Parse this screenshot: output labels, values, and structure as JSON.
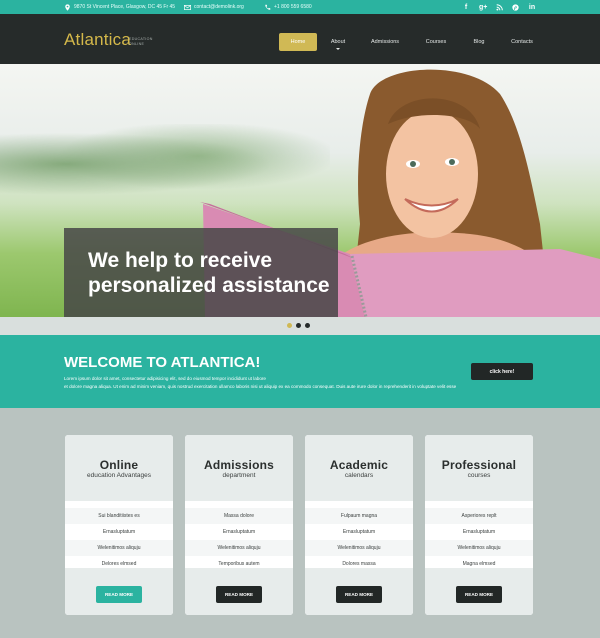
{
  "topbar": {
    "address": "9870 St Vincent Place, Glasgow, DC 45 Fr 45",
    "email": "contact@demolink.org",
    "phone": "+1 800 559 6580",
    "social": [
      "f",
      "g+",
      "rss",
      "p",
      "in"
    ]
  },
  "header": {
    "logo": "Atlantica",
    "tagline_line1": "EDUCATION",
    "tagline_line2": "ONLINE",
    "nav": [
      "Home",
      "About",
      "Admissions",
      "Courses",
      "Blog",
      "Contacts"
    ],
    "active_nav": "Home"
  },
  "hero": {
    "caption_line1": "We help to receive",
    "caption_line2": "personalized assistance",
    "slides_count": 3,
    "active_slide": 1
  },
  "welcome": {
    "title": "WELCOME TO ATLANTICA!",
    "text_line1": "Lorem ipsum dolor sit amet, consectetur adipisicing elit, sed do eiusmod tempor incididunt ut labore",
    "text_line2": "et dolore magna aliqua. Ut enim ad minim veniam, quis nostrud exercitation ullamco laboris nisi ut aliquip ex ea commodo consequat. Duis aute irure dolor in reprehenderit in voluptate velit esse",
    "button": "click here!"
  },
  "cards": [
    {
      "title": "Online",
      "subtitle": "education Advantages",
      "items": [
        "Sui blanditiistes es",
        "Ernasluptatum",
        "Welenitimos aliquju",
        "Delores elmsed"
      ],
      "button": "READ MORE",
      "accent": "#2bb3a0"
    },
    {
      "title": "Admissions",
      "subtitle": "department",
      "items": [
        "Massa dolore",
        "Ernasluptatum",
        "Welenitimos aliquju",
        "Temporibus autem"
      ],
      "button": "READ MORE",
      "accent": "#222726"
    },
    {
      "title": "Academic",
      "subtitle": "calendars",
      "items": [
        "Fulpaum magna",
        "Ernasluptatum",
        "Welenitimos aliquju",
        "Dolores massa"
      ],
      "button": "READ MORE",
      "accent": "#222726"
    },
    {
      "title": "Professional",
      "subtitle": "courses",
      "items": [
        "Asperiores replt",
        "Ernasluptatum",
        "Welenitimos aliquju",
        "Magna elmsed"
      ],
      "button": "READ MORE",
      "accent": "#222726"
    }
  ],
  "colors": {
    "accent_teal": "#2bb3a0",
    "gold": "#d0b955",
    "dark": "#262b2a"
  }
}
